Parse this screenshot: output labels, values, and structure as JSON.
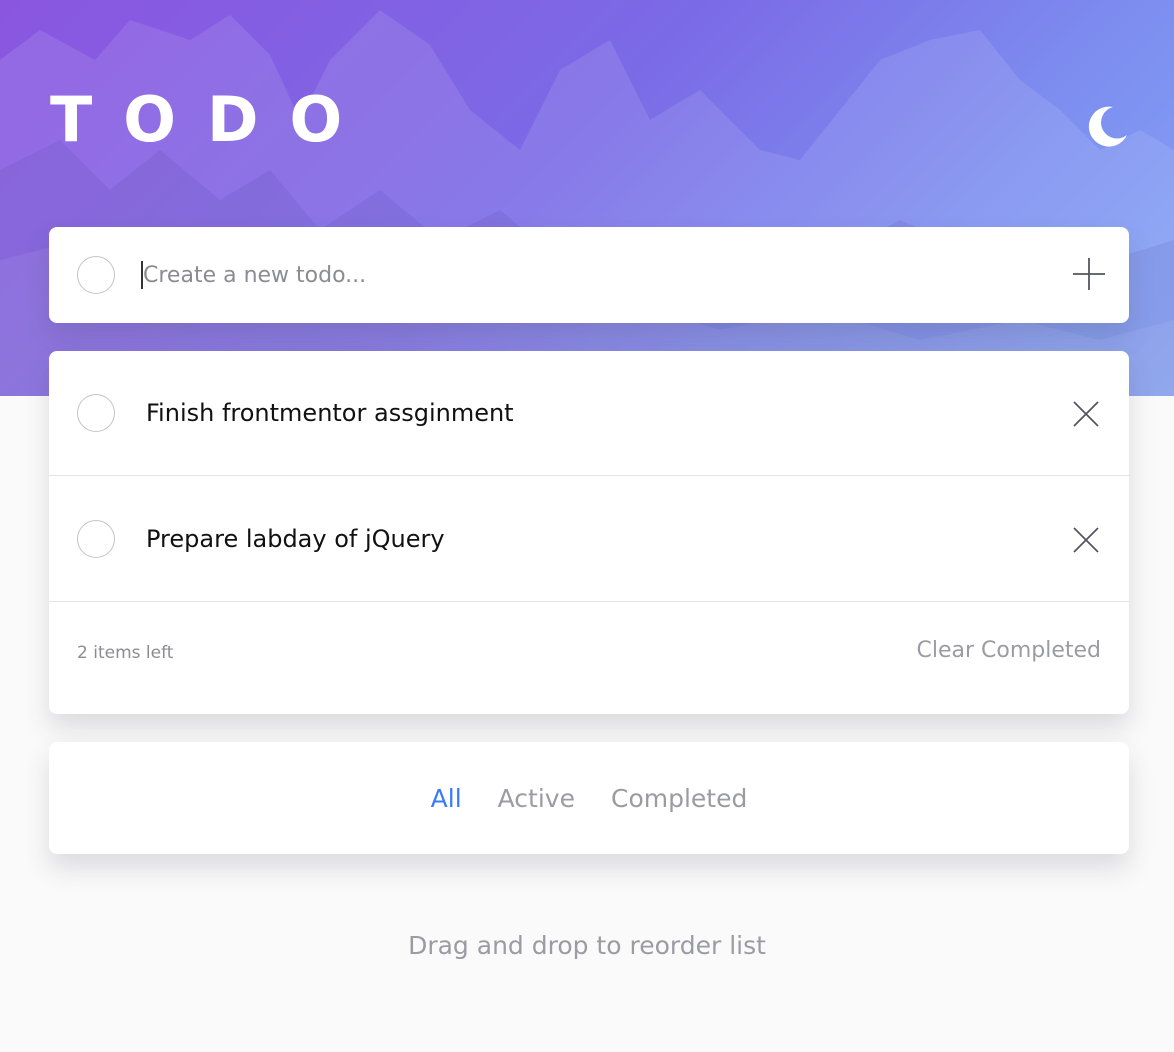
{
  "header": {
    "title": "TODO",
    "theme_icon": "moon-icon"
  },
  "new_todo": {
    "placeholder": "Create a new todo...",
    "value": "",
    "add_icon": "plus-icon"
  },
  "todos": [
    {
      "text": "Finish frontmentor assginment",
      "completed": false,
      "delete_icon": "close-icon"
    },
    {
      "text": "Prepare labday of jQuery",
      "completed": false,
      "delete_icon": "close-icon"
    }
  ],
  "footer": {
    "items_left": "2 items left",
    "clear_label": "Clear Completed"
  },
  "filters": {
    "tabs": [
      {
        "label": "All",
        "active": true
      },
      {
        "label": "Active",
        "active": false
      },
      {
        "label": "Completed",
        "active": false
      }
    ]
  },
  "hint": "Drag and drop to reorder list",
  "colors": {
    "accent": "#3a7bfd",
    "gradient_start": "#8a56e0",
    "gradient_end": "#86a6f6",
    "muted_text": "#9b9ba4",
    "background": "#fafafa"
  }
}
